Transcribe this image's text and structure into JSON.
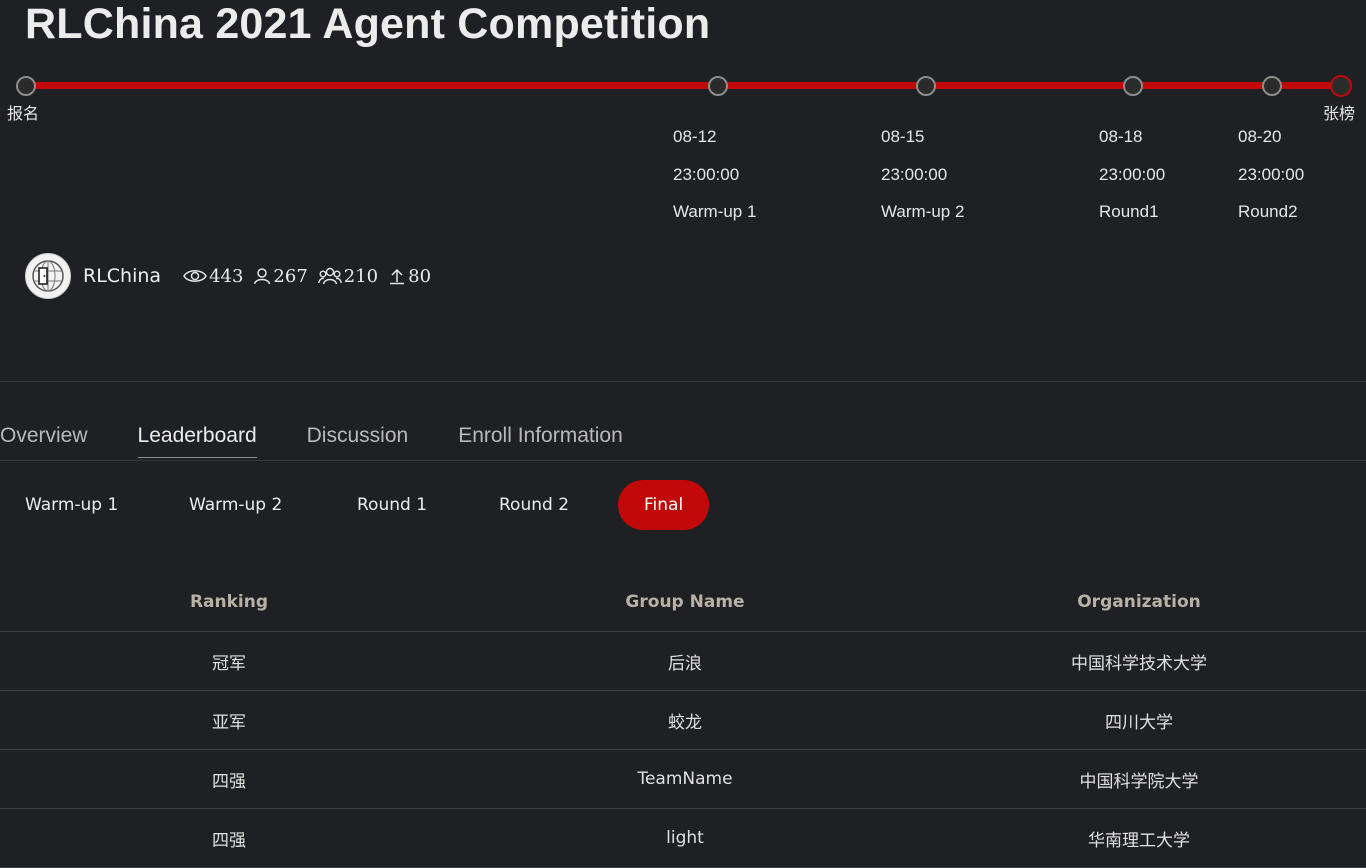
{
  "page": {
    "title": "RLChina 2021 Agent Competition"
  },
  "colors": {
    "accent": "#c20808",
    "background": "#1f2023",
    "header_text": "#b8b2a6"
  },
  "timeline": {
    "start_label": "报名",
    "end_label": "张榜",
    "stages": [
      {
        "date": "08-12",
        "time": "23:00:00",
        "name": "Warm-up 1"
      },
      {
        "date": "08-15",
        "time": "23:00:00",
        "name": "Warm-up 2"
      },
      {
        "date": "08-18",
        "time": "23:00:00",
        "name": "Round1"
      },
      {
        "date": "08-20",
        "time": "23:00:00",
        "name": "Round2"
      }
    ]
  },
  "organizer": {
    "name": "RLChina",
    "stats": {
      "views": "443",
      "participants": "267",
      "teams": "210",
      "submissions": "80"
    }
  },
  "tabs": [
    "Overview",
    "Leaderboard",
    "Discussion",
    "Enroll Information"
  ],
  "active_tab": "Leaderboard",
  "rounds": [
    "Warm-up 1",
    "Warm-up 2",
    "Round 1",
    "Round 2",
    "Final"
  ],
  "active_round": "Final",
  "leaderboard": {
    "headers": [
      "Ranking",
      "Group Name",
      "Organization"
    ],
    "rows": [
      [
        "冠军",
        "后浪",
        "中国科学技术大学"
      ],
      [
        "亚军",
        "蛟龙",
        "四川大学"
      ],
      [
        "四强",
        "TeamName",
        "中国科学院大学"
      ],
      [
        "四强",
        "light",
        "华南理工大学"
      ]
    ]
  }
}
